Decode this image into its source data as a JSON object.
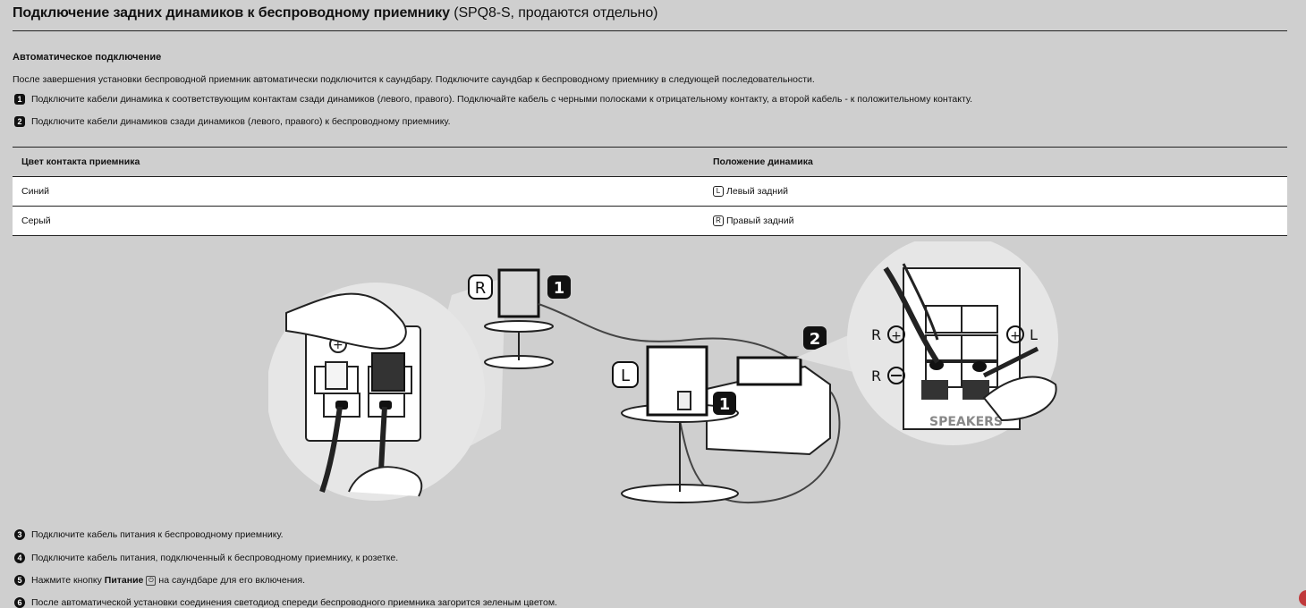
{
  "header": {
    "title_main": "Подключение задних динамиков к беспроводному приемнику",
    "title_paren": "(SPQ8-S, продаются отдельно)"
  },
  "section": {
    "subheading": "Автоматическое подключение",
    "intro": "После завершения установки беспроводной приемник автоматически подключится к саундбару. Подключите саундбар к беспроводному приемнику в следующей последовательности."
  },
  "steps_top": [
    {
      "num": "1",
      "text": "Подключите кабели динамика к соответствующим контактам сзади динамиков (левого, правого). Подключайте кабель с черными полосками к отрицательному контакту, а второй кабель - к положительному контакту."
    },
    {
      "num": "2",
      "text": "Подключите кабели динамиков сзади динамиков (левого, правого) к беспроводному приемнику."
    }
  ],
  "table": {
    "headers": [
      "Цвет контакта приемника",
      "Положение динамика"
    ],
    "rows": [
      {
        "color": "Синий",
        "letter": "L",
        "position": "Левый задний"
      },
      {
        "color": "Серый",
        "letter": "R",
        "position": "Правый задний"
      }
    ]
  },
  "illustration": {
    "label_r": "R",
    "label_l": "L",
    "callout_1": "1",
    "callout_2": "2",
    "terminal_r_plus": "R",
    "terminal_r_minus": "R",
    "terminal_l_plus": "L",
    "speakers_label": "SPEAKERS"
  },
  "steps_bottom": [
    {
      "num": "3",
      "text": "Подключите кабель питания к беспроводному приемнику."
    },
    {
      "num": "4",
      "text": "Подключите кабель питания, подключенный к беспроводному приемнику, к розетке."
    },
    {
      "num": "5",
      "text_before": "Нажмите кнопку",
      "bold": "Питание",
      "glyph": "⏻",
      "text_after": "на саундбаре для его включения."
    },
    {
      "num": "6",
      "text": "После автоматической установки соединения светодиод спереди беспроводного приемника загорится зеленым цветом."
    }
  ]
}
